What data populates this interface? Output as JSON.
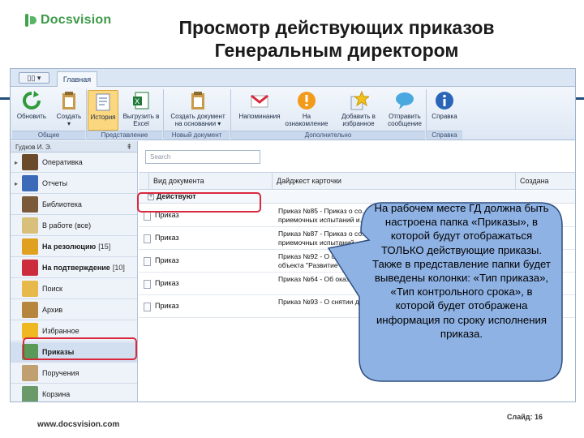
{
  "brand": {
    "name": "Docsvision",
    "color": "#3d9a48"
  },
  "slide": {
    "title": "Просмотр действующих приказов",
    "title_line2": "Генеральным директором",
    "url": "www.docsvision.com",
    "slide_label": "Слайд: 16"
  },
  "app": {
    "tab_main": "Главная",
    "ribbon": {
      "buttons": [
        {
          "label": "Обновить",
          "icon": "refresh-icon"
        },
        {
          "label": "Создать\n▾",
          "icon": "create-icon"
        },
        {
          "label": "История",
          "icon": "history-icon",
          "active": true
        },
        {
          "label": "Выгрузить в\nExcel",
          "icon": "excel-icon"
        },
        {
          "label": "Создать документ\nна основании ▾",
          "icon": "create-based-icon"
        },
        {
          "label": "Напоминания",
          "icon": "mail-icon"
        },
        {
          "label": "На\nознакомление",
          "icon": "alert-icon"
        },
        {
          "label": "Добавить в\nизбранное",
          "icon": "star-icon"
        },
        {
          "label": "Отправить\nсообщение",
          "icon": "message-icon"
        },
        {
          "label": "Справка",
          "icon": "info-icon"
        }
      ],
      "groups": [
        "Общие",
        "Представление",
        "Новый документ",
        "Дополнительно",
        "Справка"
      ]
    },
    "sidebar": {
      "user": "Гудков И. Э.",
      "items": [
        {
          "label": "Оперативка",
          "icon": "folder-stack-icon",
          "has_arrow": true
        },
        {
          "label": "Отчеты",
          "icon": "reports-icon",
          "has_arrow": true
        },
        {
          "label": "Библиотека",
          "icon": "library-icon",
          "has_arrow": false
        },
        {
          "label": "В работе (все)",
          "icon": "in-work-icon",
          "has_arrow": false
        },
        {
          "label": "На резолюцию",
          "count": "[15]",
          "icon": "resolution-icon",
          "bold": true
        },
        {
          "label": "На подтверждение",
          "count": "[10]",
          "icon": "confirm-icon",
          "bold": true
        },
        {
          "label": "Поиск",
          "icon": "search-folder-icon"
        },
        {
          "label": "Архив",
          "icon": "archive-icon"
        },
        {
          "label": "Избранное",
          "icon": "favorites-icon"
        },
        {
          "label": "Приказы",
          "icon": "orders-icon",
          "bold": true,
          "selected": true
        },
        {
          "label": "Поручения",
          "icon": "tasks-icon"
        },
        {
          "label": "Корзина",
          "icon": "trash-icon"
        }
      ]
    },
    "search": {
      "placeholder": "Search"
    },
    "grid": {
      "columns": [
        "Вид документа",
        "Дайджест карточки",
        "Создана"
      ],
      "group_label": "Действуют",
      "rows": [
        {
          "type": "Приказ",
          "digest": "Приказ №85 - Приказ о со...\nприемочных испытаний и..."
        },
        {
          "type": "Приказ",
          "digest": "Приказ №87 - Приказ о со...\nприемочных испытаний ..."
        },
        {
          "type": "Приказ",
          "digest": "Приказ №92 - О соз...\nобъекта \"Развитие тра..."
        },
        {
          "type": "Приказ",
          "digest": "Приказ №64 - Об оказан..."
        },
        {
          "type": "Приказ",
          "digest": "Приказ №93 - О снятии д..."
        }
      ]
    }
  },
  "callout": {
    "text": "На рабочем месте ГД должна быть настроена папка «Приказы», в которой будут отображаться ТОЛЬКО действующие приказы. Также в представление папки будет выведены колонки: «Тип приказа», «Тип контрольного срока», в которой будет отображена информация по сроку исполнения приказа.",
    "fill": "#8fb2e4",
    "stroke": "#2f4f7f"
  },
  "highlight_color": "#d9283c"
}
